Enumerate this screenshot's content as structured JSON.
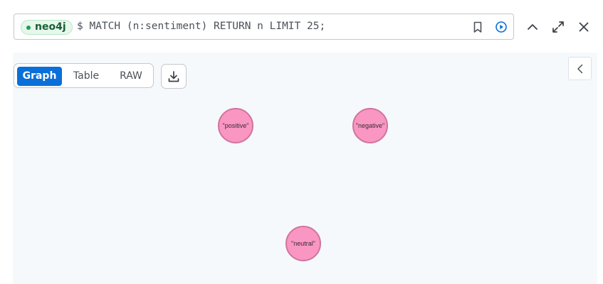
{
  "query_bar": {
    "database": "neo4j",
    "query": "$ MATCH (n:sentiment) RETURN n LIMIT 25;"
  },
  "result": {
    "tabs": [
      {
        "label": "Graph",
        "active": true
      },
      {
        "label": "Table",
        "active": false
      },
      {
        "label": "RAW",
        "active": false
      }
    ],
    "graph": {
      "node_fill": "#f996c2",
      "node_stroke": "#d2739e",
      "nodes": [
        {
          "label": "\"positive\""
        },
        {
          "label": "\"negative\""
        },
        {
          "label": "\"neutral\""
        }
      ]
    }
  },
  "icons": {
    "bookmark": "bookmark-icon",
    "run": "play-circle-icon",
    "collapse_up": "chevron-up-icon",
    "fullscreen": "expand-icon",
    "close": "close-icon",
    "download": "download-icon",
    "panel_toggle": "chevron-left-icon"
  },
  "colors": {
    "accent": "#0a6fd8",
    "badge_bg": "#e6f7ec",
    "badge_text": "#1a5e36",
    "panel_bg": "#f6f9fc"
  }
}
